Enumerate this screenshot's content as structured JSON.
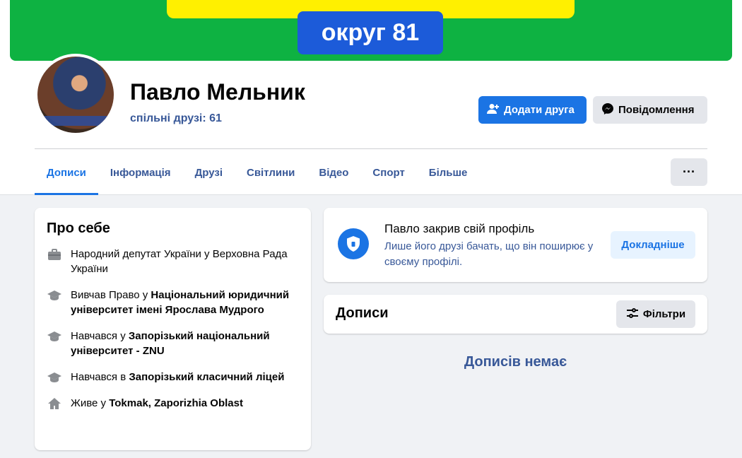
{
  "cover": {
    "badge_text": "округ 81"
  },
  "profile": {
    "name": "Павло Мельник",
    "mutual_friends": "спільні друзі: 61"
  },
  "actions": {
    "add_friend": "Додати друга",
    "message": "Повідомлення"
  },
  "tabs": [
    "Дописи",
    "Інформація",
    "Друзі",
    "Світлини",
    "Відео",
    "Спорт",
    "Більше"
  ],
  "more_menu": "···",
  "about": {
    "title": "Про себе",
    "items": [
      {
        "icon": "briefcase-icon",
        "text": "Народний депутат України у Верховна Рада України",
        "bold": ""
      },
      {
        "icon": "graduation-cap-icon",
        "text": "Вивчав Право у ",
        "bold": "Національний юридичний університет імені Ярослава Мудрого"
      },
      {
        "icon": "graduation-cap-icon",
        "text": "Навчався у ",
        "bold": "Запорізький національний університет - ZNU"
      },
      {
        "icon": "graduation-cap-icon",
        "text": "Навчався в ",
        "bold": "Запорізький класичний ліцей"
      },
      {
        "icon": "home-icon",
        "text": "Живе у ",
        "bold": "Tokmak, Zaporizhia Oblast"
      }
    ]
  },
  "locked_profile": {
    "title": "Павло закрив свій профіль",
    "description": "Лише його друзі бачать, що він поширює у своєму профілі.",
    "button": "Докладніше"
  },
  "posts": {
    "title": "Дописи",
    "filter_button": "Фільтри",
    "empty_text": "Дописів немає"
  },
  "colors": {
    "primary": "#1b74e4",
    "cover_green": "#0eb242",
    "cover_yellow": "#fff000",
    "badge_blue": "#1c5bd9"
  }
}
